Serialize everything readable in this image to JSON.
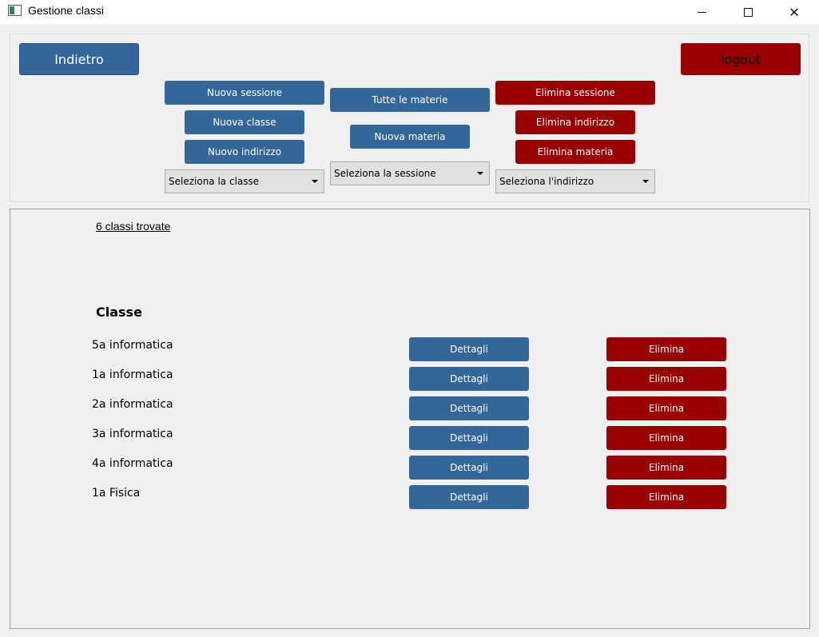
{
  "window": {
    "title": "Gestione classi",
    "minimize_glyph": "",
    "close_glyph": "✕"
  },
  "toolbar": {
    "back_label": "Indietro",
    "logout_label": "logout",
    "new_session_label": "Nuova sessione",
    "new_class_label": "Nuova classe",
    "new_address_label": "Nuovo indirizzo",
    "all_subjects_label": "Tutte le materie",
    "new_subject_label": "Nuova materia",
    "delete_session_label": "Elimina sessione",
    "delete_address_label": "Elimina indirizzo",
    "delete_subject_label": "Elimina materia",
    "class_select": "Seleziona la classe",
    "session_select": "Seleziona la sessione",
    "address_select": "Seleziona l'indirizzo"
  },
  "list": {
    "count_text": "6 classi trovate",
    "header": "Classe",
    "details_label": "Dettagli",
    "delete_label": "Elimina",
    "rows": [
      {
        "name": "5a informatica"
      },
      {
        "name": "1a informatica"
      },
      {
        "name": "2a informatica"
      },
      {
        "name": "3a informatica"
      },
      {
        "name": "4a informatica"
      },
      {
        "name": "1a Fisica"
      }
    ]
  },
  "colors": {
    "primary_blue": "#336699",
    "danger_red": "#990000",
    "window_bg": "#f0f0f0"
  }
}
